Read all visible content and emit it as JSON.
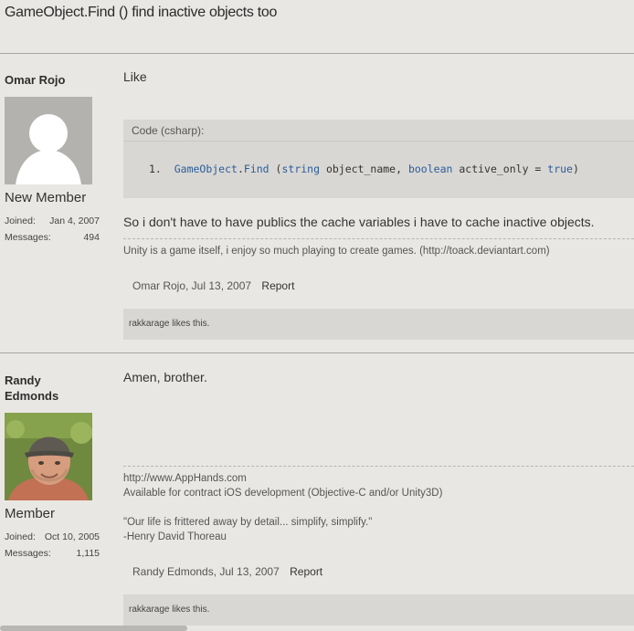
{
  "thread": {
    "title": "GameObject.Find () find inactive objects too"
  },
  "posts": [
    {
      "username": "Omar Rojo",
      "user_title": "New Member",
      "joined_label": "Joined:",
      "joined": "Jan 4, 2007",
      "messages_label": "Messages:",
      "messages": "494",
      "message": "Like",
      "code_header": "Code (csharp):",
      "code_number": "1.",
      "code": {
        "t1": "GameObject",
        "t2": ".",
        "t3": "Find",
        "t4": " (",
        "t5": "string",
        "t6": " object_name, ",
        "t7": "boolean",
        "t8": " active_only = ",
        "t9": "true",
        "t10": ")"
      },
      "message2": "So i don't have to have publics the cache variables i have to cache inactive objects.",
      "signature": "Unity is a game itself, i enjoy so much playing to create games. (http://toack.deviantart.com)",
      "author_date": "Omar Rojo, Jul 13, 2007",
      "report": "Report",
      "likes": "rakkarage likes this."
    },
    {
      "username_line1": "Randy",
      "username_line2": "Edmonds",
      "user_title": "Member",
      "joined_label": "Joined:",
      "joined": "Oct 10, 2005",
      "messages_label": "Messages:",
      "messages": "1,115",
      "message": "Amen, brother.",
      "signature": [
        "http://www.AppHands.com",
        "Available for contract iOS development (Objective-C and/or Unity3D)",
        "",
        "\"Our life is frittered away by detail... simplify, simplify.\"",
        "-Henry David Thoreau"
      ],
      "author_date": "Randy Edmonds, Jul 13, 2007",
      "report": "Report",
      "likes": "rakkarage likes this."
    }
  ],
  "colors": {
    "background": "#e9e7e3",
    "panel": "#d9d7d3",
    "code_keyword": "#2a5d9a"
  },
  "icons": {
    "default_avatar": "default-avatar-icon"
  }
}
